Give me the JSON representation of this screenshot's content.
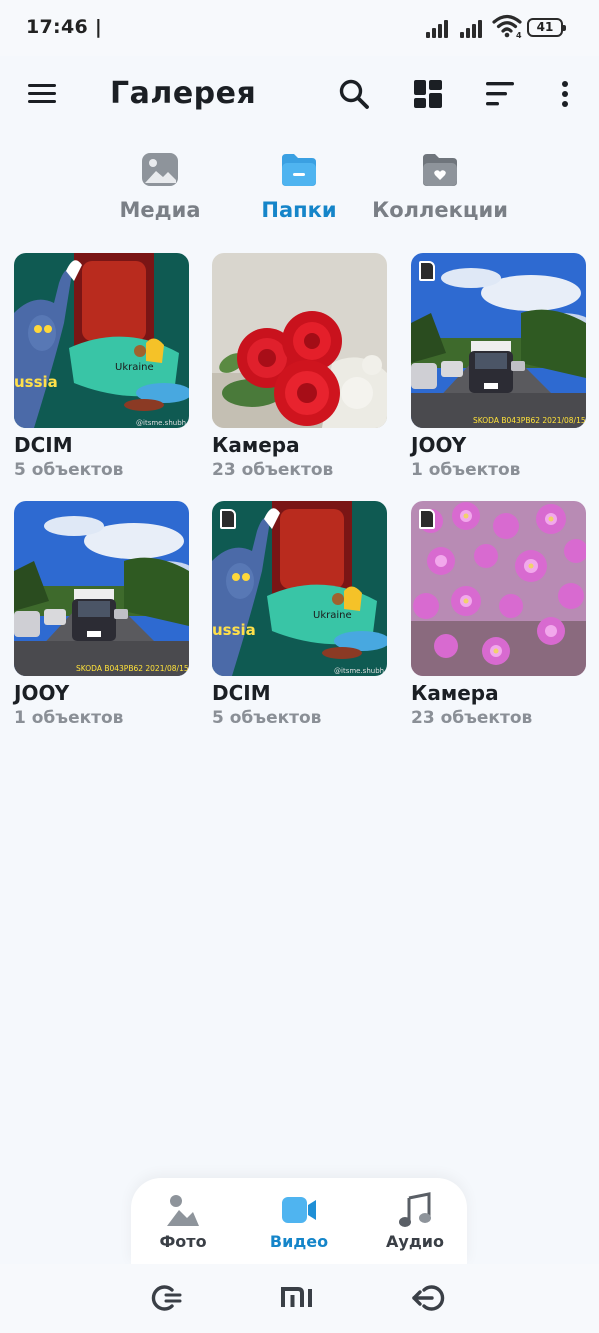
{
  "status_bar": {
    "time": "17:46 |",
    "battery": "41"
  },
  "app_bar": {
    "title": "Галерея"
  },
  "tabs": [
    {
      "label": "Медиа",
      "icon": "image-icon",
      "active": false
    },
    {
      "label": "Папки",
      "icon": "folder-icon",
      "active": true
    },
    {
      "label": "Коллекции",
      "icon": "collection-folder-icon",
      "active": false
    }
  ],
  "albums": [
    {
      "name": "DCIM",
      "count": "5 объектов",
      "thumb": "cartoon-meme",
      "sd": false,
      "watermark": "@itsme.shubh",
      "overlay_text": "ussia",
      "overlay_text2": "Ukraine"
    },
    {
      "name": "Камера",
      "count": "23 объектов",
      "thumb": "roses",
      "sd": false
    },
    {
      "name": "JOOY",
      "count": "1 объектов",
      "thumb": "road",
      "sd": true,
      "stamp": "SKODA  B043PB62  2021/08/15"
    },
    {
      "name": "JOOY",
      "count": "1 объектов",
      "thumb": "road",
      "sd": false,
      "stamp": "SKODA  B043PB62  2021/08/15"
    },
    {
      "name": "DCIM",
      "count": "5 объектов",
      "thumb": "cartoon-meme",
      "sd": true,
      "watermark": "@itsme.shubh",
      "overlay_text": "ussia",
      "overlay_text2": "Ukraine"
    },
    {
      "name": "Камера",
      "count": "23 объектов",
      "thumb": "flowers",
      "sd": true
    }
  ],
  "bottom_nav": [
    {
      "label": "Фото",
      "icon": "photo-icon",
      "active": false
    },
    {
      "label": "Видео",
      "icon": "video-icon",
      "active": true
    },
    {
      "label": "Аудио",
      "icon": "music-icon",
      "active": false
    }
  ],
  "colors": {
    "accent": "#1585c9",
    "background": "#f5f8fc"
  }
}
